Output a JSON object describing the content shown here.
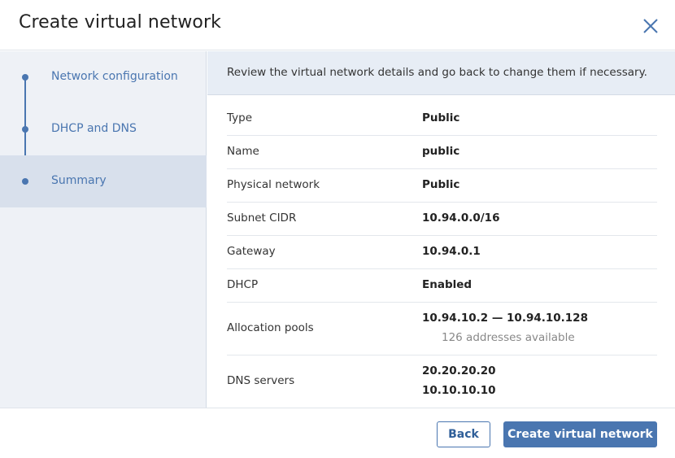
{
  "dialog": {
    "title": "Create virtual network"
  },
  "sidebar": {
    "steps": [
      {
        "label": "Network configuration",
        "active": false
      },
      {
        "label": "DHCP and DNS",
        "active": false
      },
      {
        "label": "Summary",
        "active": true
      }
    ]
  },
  "summary": {
    "notice": "Review the virtual network details and go back to change them if necessary.",
    "rows": [
      {
        "label": "Type",
        "value": "Public"
      },
      {
        "label": "Name",
        "value": "public"
      },
      {
        "label": "Physical network",
        "value": "Public"
      },
      {
        "label": "Subnet CIDR",
        "value": "10.94.0.0/16"
      },
      {
        "label": "Gateway",
        "value": "10.94.0.1"
      },
      {
        "label": "DHCP",
        "value": "Enabled"
      },
      {
        "label": "Allocation pools",
        "value": "10.94.10.2 — 10.94.10.128",
        "sub": "126 addresses available"
      },
      {
        "label": "DNS servers",
        "values": [
          "20.20.20.20",
          "10.10.10.10"
        ]
      }
    ]
  },
  "footer": {
    "back_label": "Back",
    "create_label": "Create virtual network"
  },
  "colors": {
    "accent": "#4a76b0",
    "sidebar_bg": "#eef1f6",
    "active_step_bg": "#d8e0ec",
    "notice_bg": "#e7edf5"
  }
}
